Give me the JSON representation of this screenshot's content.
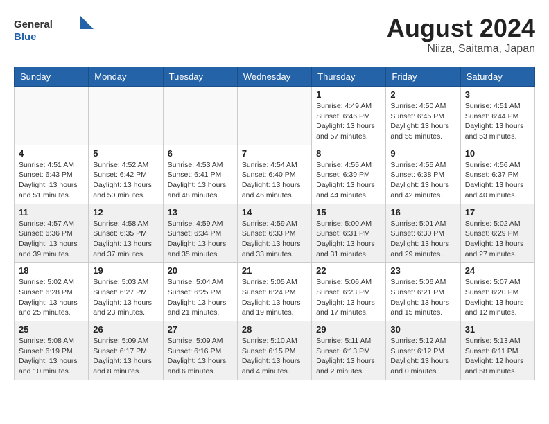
{
  "header": {
    "logo_general": "General",
    "logo_blue": "Blue",
    "month_year": "August 2024",
    "location": "Niiza, Saitama, Japan"
  },
  "weekdays": [
    "Sunday",
    "Monday",
    "Tuesday",
    "Wednesday",
    "Thursday",
    "Friday",
    "Saturday"
  ],
  "weeks": [
    [
      {
        "day": "",
        "info": ""
      },
      {
        "day": "",
        "info": ""
      },
      {
        "day": "",
        "info": ""
      },
      {
        "day": "",
        "info": ""
      },
      {
        "day": "1",
        "info": "Sunrise: 4:49 AM\nSunset: 6:46 PM\nDaylight: 13 hours\nand 57 minutes."
      },
      {
        "day": "2",
        "info": "Sunrise: 4:50 AM\nSunset: 6:45 PM\nDaylight: 13 hours\nand 55 minutes."
      },
      {
        "day": "3",
        "info": "Sunrise: 4:51 AM\nSunset: 6:44 PM\nDaylight: 13 hours\nand 53 minutes."
      }
    ],
    [
      {
        "day": "4",
        "info": "Sunrise: 4:51 AM\nSunset: 6:43 PM\nDaylight: 13 hours\nand 51 minutes."
      },
      {
        "day": "5",
        "info": "Sunrise: 4:52 AM\nSunset: 6:42 PM\nDaylight: 13 hours\nand 50 minutes."
      },
      {
        "day": "6",
        "info": "Sunrise: 4:53 AM\nSunset: 6:41 PM\nDaylight: 13 hours\nand 48 minutes."
      },
      {
        "day": "7",
        "info": "Sunrise: 4:54 AM\nSunset: 6:40 PM\nDaylight: 13 hours\nand 46 minutes."
      },
      {
        "day": "8",
        "info": "Sunrise: 4:55 AM\nSunset: 6:39 PM\nDaylight: 13 hours\nand 44 minutes."
      },
      {
        "day": "9",
        "info": "Sunrise: 4:55 AM\nSunset: 6:38 PM\nDaylight: 13 hours\nand 42 minutes."
      },
      {
        "day": "10",
        "info": "Sunrise: 4:56 AM\nSunset: 6:37 PM\nDaylight: 13 hours\nand 40 minutes."
      }
    ],
    [
      {
        "day": "11",
        "info": "Sunrise: 4:57 AM\nSunset: 6:36 PM\nDaylight: 13 hours\nand 39 minutes."
      },
      {
        "day": "12",
        "info": "Sunrise: 4:58 AM\nSunset: 6:35 PM\nDaylight: 13 hours\nand 37 minutes."
      },
      {
        "day": "13",
        "info": "Sunrise: 4:59 AM\nSunset: 6:34 PM\nDaylight: 13 hours\nand 35 minutes."
      },
      {
        "day": "14",
        "info": "Sunrise: 4:59 AM\nSunset: 6:33 PM\nDaylight: 13 hours\nand 33 minutes."
      },
      {
        "day": "15",
        "info": "Sunrise: 5:00 AM\nSunset: 6:31 PM\nDaylight: 13 hours\nand 31 minutes."
      },
      {
        "day": "16",
        "info": "Sunrise: 5:01 AM\nSunset: 6:30 PM\nDaylight: 13 hours\nand 29 minutes."
      },
      {
        "day": "17",
        "info": "Sunrise: 5:02 AM\nSunset: 6:29 PM\nDaylight: 13 hours\nand 27 minutes."
      }
    ],
    [
      {
        "day": "18",
        "info": "Sunrise: 5:02 AM\nSunset: 6:28 PM\nDaylight: 13 hours\nand 25 minutes."
      },
      {
        "day": "19",
        "info": "Sunrise: 5:03 AM\nSunset: 6:27 PM\nDaylight: 13 hours\nand 23 minutes."
      },
      {
        "day": "20",
        "info": "Sunrise: 5:04 AM\nSunset: 6:25 PM\nDaylight: 13 hours\nand 21 minutes."
      },
      {
        "day": "21",
        "info": "Sunrise: 5:05 AM\nSunset: 6:24 PM\nDaylight: 13 hours\nand 19 minutes."
      },
      {
        "day": "22",
        "info": "Sunrise: 5:06 AM\nSunset: 6:23 PM\nDaylight: 13 hours\nand 17 minutes."
      },
      {
        "day": "23",
        "info": "Sunrise: 5:06 AM\nSunset: 6:21 PM\nDaylight: 13 hours\nand 15 minutes."
      },
      {
        "day": "24",
        "info": "Sunrise: 5:07 AM\nSunset: 6:20 PM\nDaylight: 13 hours\nand 12 minutes."
      }
    ],
    [
      {
        "day": "25",
        "info": "Sunrise: 5:08 AM\nSunset: 6:19 PM\nDaylight: 13 hours\nand 10 minutes."
      },
      {
        "day": "26",
        "info": "Sunrise: 5:09 AM\nSunset: 6:17 PM\nDaylight: 13 hours\nand 8 minutes."
      },
      {
        "day": "27",
        "info": "Sunrise: 5:09 AM\nSunset: 6:16 PM\nDaylight: 13 hours\nand 6 minutes."
      },
      {
        "day": "28",
        "info": "Sunrise: 5:10 AM\nSunset: 6:15 PM\nDaylight: 13 hours\nand 4 minutes."
      },
      {
        "day": "29",
        "info": "Sunrise: 5:11 AM\nSunset: 6:13 PM\nDaylight: 13 hours\nand 2 minutes."
      },
      {
        "day": "30",
        "info": "Sunrise: 5:12 AM\nSunset: 6:12 PM\nDaylight: 13 hours\nand 0 minutes."
      },
      {
        "day": "31",
        "info": "Sunrise: 5:13 AM\nSunset: 6:11 PM\nDaylight: 12 hours\nand 58 minutes."
      }
    ]
  ]
}
